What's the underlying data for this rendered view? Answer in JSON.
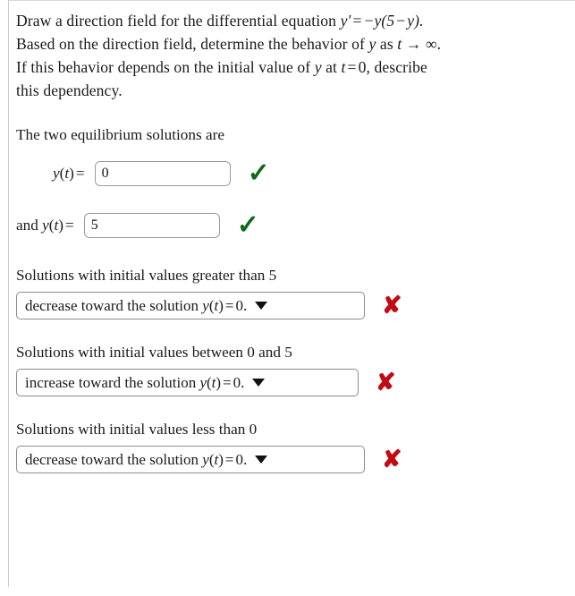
{
  "problem": {
    "line1_a": "Draw a direction field for the differential equation",
    "line1_math_yprime": "y",
    "line1_math_prime": "′",
    "line1_math_eq": "=",
    "line1_math_rhs_a": "−y(5",
    "line1_math_minus": "−",
    "line1_math_rhs_b": "y).",
    "line2_a": "Based on the direction field, determine the behavior of",
    "line2_y": "y",
    "line2_as": "as",
    "line2_t": "t",
    "line2_arrow": "→",
    "line2_inf": "∞.",
    "line3_a": "If this behavior depends on the initial value of",
    "line3_y": "y",
    "line3_at": "at",
    "line3_t": "t",
    "line3_eq": "=",
    "line3_zero": "0,",
    "line3_b": "describe",
    "line4": "this dependency."
  },
  "equilibrium": {
    "heading": "The two equilibrium solutions are",
    "row1": {
      "lead_y": "y",
      "lead_paren_open": "(",
      "lead_t": "t",
      "lead_paren_close": ")",
      "lead_eq": "=",
      "value": "0",
      "placeholder": "",
      "mark": "✓",
      "mark_name": "correct",
      "mark_color": "#0a6b16"
    },
    "row2": {
      "lead_and": "and",
      "lead_y": "y",
      "lead_paren_open": "(",
      "lead_t": "t",
      "lead_paren_close": ")",
      "lead_eq": "=",
      "value": "5",
      "placeholder": "",
      "mark": "✓",
      "mark_name": "correct",
      "mark_color": "#0a6b16"
    }
  },
  "questions": [
    {
      "label_a": "Solutions with initial values greater than 5",
      "answer_verb": "decrease toward the solution",
      "answer_y": "y",
      "answer_paren_open": "(",
      "answer_t": "t",
      "answer_paren_close": ")",
      "answer_eq": "=",
      "answer_value": "0.",
      "width_px": "390",
      "mark": "✘",
      "mark_name": "incorrect",
      "mark_color": "#c10b14"
    },
    {
      "label_a": "Solutions with initial values between 0 and 5",
      "answer_verb": "increase toward the solution",
      "answer_y": "y",
      "answer_paren_open": "(",
      "answer_t": "t",
      "answer_paren_close": ")",
      "answer_eq": "=",
      "answer_value": "0.",
      "width_px": "383",
      "mark": "✘",
      "mark_name": "incorrect",
      "mark_color": "#c10b14"
    },
    {
      "label_a": "Solutions with initial values less than 0",
      "answer_verb": "decrease toward the solution",
      "answer_y": "y",
      "answer_paren_open": "(",
      "answer_t": "t",
      "answer_paren_close": ")",
      "answer_eq": "=",
      "answer_value": "0.",
      "width_px": "390",
      "mark": "✘",
      "mark_name": "incorrect",
      "mark_color": "#c10b14"
    }
  ]
}
